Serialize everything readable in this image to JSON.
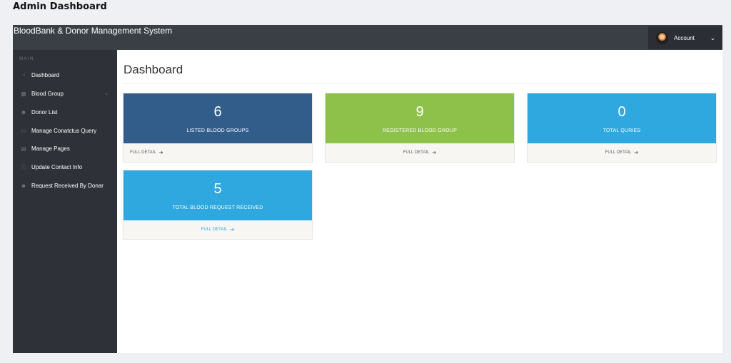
{
  "page": {
    "heading": "Admin Dashboard"
  },
  "header": {
    "brand": "BloodBank & Donor Management System",
    "account_label": "Account"
  },
  "sidebar": {
    "section_label": "MAIN",
    "items": [
      {
        "label": "Dashboard",
        "icon": "dashboard-icon"
      },
      {
        "label": "Blood Group",
        "icon": "table-icon",
        "has_submenu": true
      },
      {
        "label": "Donor List",
        "icon": "users-icon"
      },
      {
        "label": "Manage Conatctus Query",
        "icon": "desktop-icon"
      },
      {
        "label": "Manage Pages",
        "icon": "file-icon"
      },
      {
        "label": "Update Contact Info",
        "icon": "info-icon"
      },
      {
        "label": "Request Received By Donar",
        "icon": "users-icon"
      }
    ]
  },
  "main": {
    "title": "Dashboard",
    "cards": [
      {
        "value": "6",
        "label": "LISTED BLOOD GROUPS",
        "link": "FULL DETAIL",
        "color": "#325d8b"
      },
      {
        "value": "9",
        "label": "REGISTERED BLOOD GROUP",
        "link": "FULL DETAIL",
        "color": "#8dc14a"
      },
      {
        "value": "0",
        "label": "TOTAL QURIES",
        "link": "FULL DETAIL",
        "color": "#2ea8de"
      },
      {
        "value": "5",
        "label": "TOTAL BLOOD REQUEST RECEIVED",
        "link": "FULL DETAIL",
        "color": "#2ea8de"
      }
    ]
  },
  "colors": {
    "topbar": "#3a3f46",
    "sidebar": "#2e3238",
    "background": "#eef0f4"
  }
}
